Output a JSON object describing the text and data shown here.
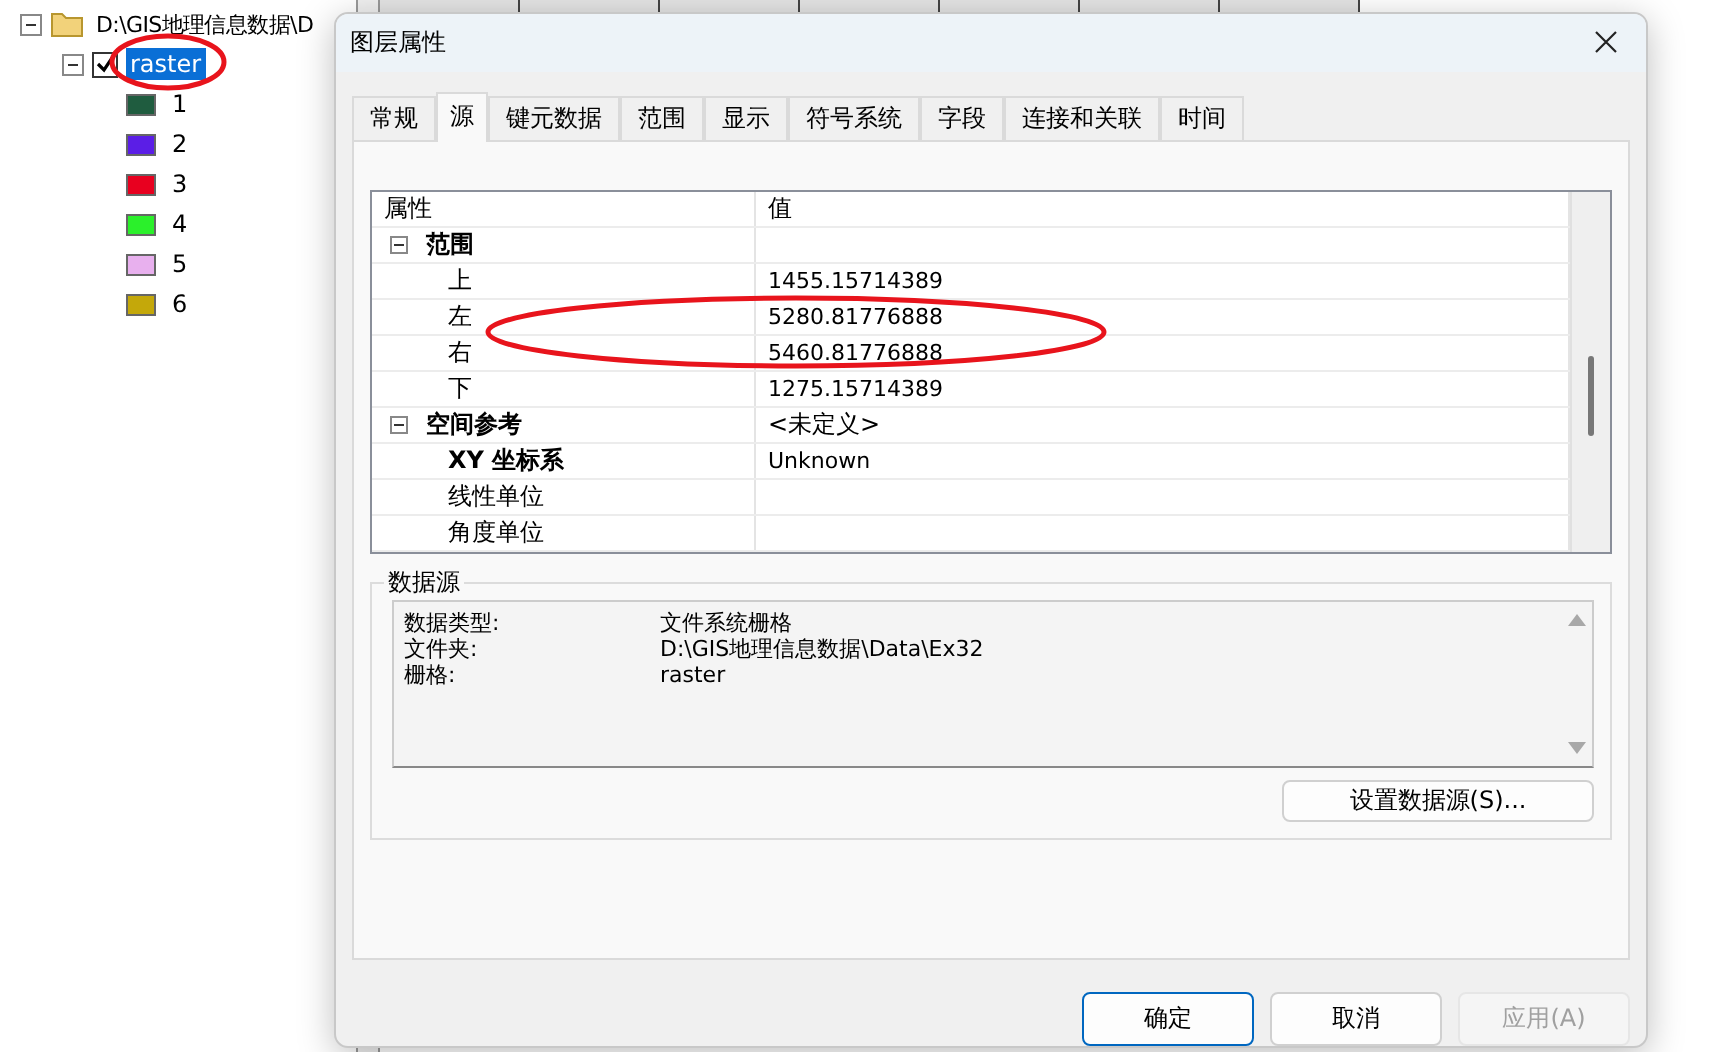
{
  "tree": {
    "label": "D:\\GIS地理信息数据\\D",
    "expanded": true,
    "children": [
      {
        "label": "raster",
        "checked": true,
        "selected": true,
        "expanded": true,
        "legend": [
          {
            "label": "1",
            "color": "#1f5c3f"
          },
          {
            "label": "2",
            "color": "#5b1ee6"
          },
          {
            "label": "3",
            "color": "#e8001f"
          },
          {
            "label": "4",
            "color": "#2bf02b"
          },
          {
            "label": "5",
            "color": "#e8b0ee"
          },
          {
            "label": "6",
            "color": "#c4a80a"
          }
        ]
      }
    ]
  },
  "dialog": {
    "title": "图层属性",
    "tabs": [
      {
        "label": "常规",
        "selected": false
      },
      {
        "label": "源",
        "selected": true
      },
      {
        "label": "键元数据",
        "selected": false
      },
      {
        "label": "范围",
        "selected": false
      },
      {
        "label": "显示",
        "selected": false
      },
      {
        "label": "符号系统",
        "selected": false
      },
      {
        "label": "字段",
        "selected": false
      },
      {
        "label": "连接和关联",
        "selected": false
      },
      {
        "label": "时间",
        "selected": false
      }
    ],
    "property_grid": {
      "columns": [
        "属性",
        "值"
      ],
      "rows": [
        {
          "label": "范围",
          "expanded": true,
          "children": [
            {
              "label": "上",
              "value": "1455.15714389"
            },
            {
              "label": "左",
              "value": "5280.81776888"
            },
            {
              "label": "右",
              "value": "5460.81776888"
            },
            {
              "label": "下",
              "value": "1275.15714389"
            }
          ]
        },
        {
          "label": "空间参考",
          "value": "<未定义>",
          "expanded": true,
          "children": [
            {
              "label": "XY 坐标系",
              "value": "Unknown",
              "bold": true
            },
            {
              "label": "线性单位"
            },
            {
              "label": "角度单位"
            }
          ]
        }
      ]
    },
    "data_source": {
      "title": "数据源",
      "fields": [
        {
          "label": "数据类型:",
          "value": "文件系统栅格"
        },
        {
          "label": "文件夹:",
          "value": "D:\\GIS地理信息数据\\Data\\Ex32"
        },
        {
          "label": "栅格:",
          "value": "raster"
        }
      ],
      "button": "设置数据源(S)..."
    },
    "buttons": [
      {
        "label": "确定",
        "default": true,
        "disabled": false
      },
      {
        "label": "取消",
        "default": false,
        "disabled": false
      },
      {
        "label": "应用(A)",
        "default": false,
        "disabled": true
      }
    ]
  }
}
